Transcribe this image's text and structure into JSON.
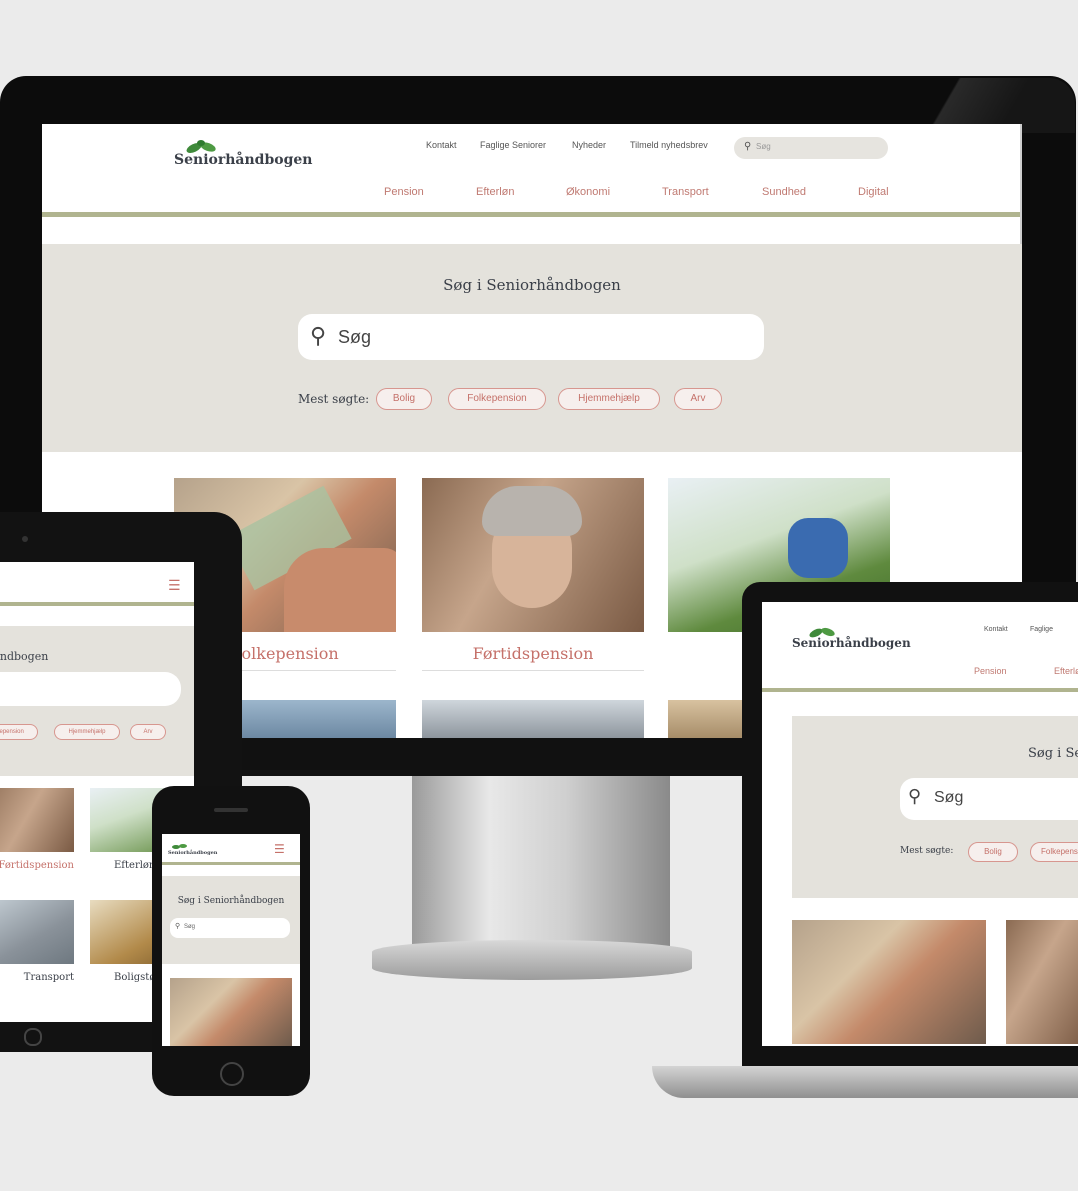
{
  "brand": {
    "logo_text": "Seniorhåndbogen",
    "accent": "#c5716a",
    "leaf_color": "#3f8a3a",
    "rule_color": "#b0b48f"
  },
  "desktop": {
    "top_links": [
      "Kontakt",
      "Faglige Seniorer",
      "Nyheder",
      "Tilmeld nyhedsbrev"
    ],
    "search_placeholder": "Søg",
    "nav": [
      "Pension",
      "Efterløn",
      "Økonomi",
      "Transport",
      "Sundhed",
      "Digital"
    ],
    "hero_title": "Søg i Seniorhåndbogen",
    "hero_search_placeholder": "Søg",
    "most_searched_label": "Mest søgte:",
    "chips": [
      "Bolig",
      "Folkepension",
      "Hjemmehjælp",
      "Arv"
    ],
    "cards": [
      "Folkepension",
      "Førtidspension",
      ""
    ]
  },
  "tablet": {
    "hero_title": "Søg i Seniorhåndbogen",
    "chips": [
      "Folkepension",
      "Hjemmehjælp",
      "Arv"
    ],
    "cards": [
      "Førtidspension",
      "Efterløn",
      "Transport",
      "Boligstøtte"
    ]
  },
  "phone": {
    "logo_text": "Seniorhåndbogen",
    "hero_title": "Søg i Seniorhåndbogen",
    "search_placeholder": "Søg"
  },
  "laptop": {
    "top_links": [
      "Kontakt",
      "Faglige"
    ],
    "nav": [
      "Pension",
      "Efterløn"
    ],
    "hero_title": "Søg i Seniorhåndbogen",
    "search_placeholder": "Søg",
    "most_searched_label": "Mest søgte:",
    "chips": [
      "Bolig",
      "Folkepension"
    ]
  }
}
